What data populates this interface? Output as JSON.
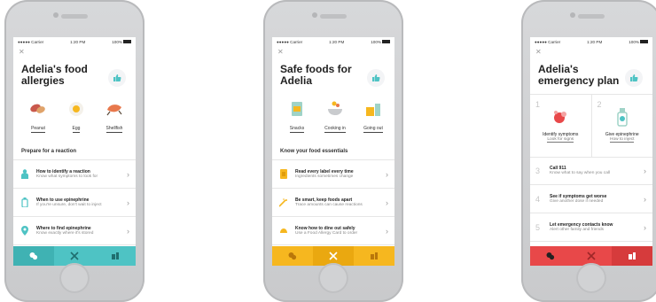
{
  "colors": {
    "teal": "#4ec3c4",
    "yellow": "#f6b71f",
    "red": "#e84849"
  },
  "status": {
    "carrier": "Carrier",
    "time": "1:20 PM",
    "battery": "100%"
  },
  "screens": [
    {
      "title": "Adelia's food allergies",
      "allergens": [
        {
          "label": "Peanut",
          "icon": "peanut-icon"
        },
        {
          "label": "Egg",
          "icon": "egg-icon"
        },
        {
          "label": "Shellfish",
          "icon": "shellfish-icon"
        }
      ],
      "section": "Prepare for a reaction",
      "rows": [
        {
          "title": "How to identify a reaction",
          "subtitle": "Know what symptoms to look for",
          "icon": "person-icon"
        },
        {
          "title": "When to use epinephrine",
          "subtitle": "If you're unsure, don't wait to inject",
          "icon": "epinephrine-icon"
        },
        {
          "title": "Where to find epinephrine",
          "subtitle": "Know exactly where it's stored",
          "icon": "location-pin-icon"
        }
      ]
    },
    {
      "title": "Safe foods for Adelia",
      "categories": [
        {
          "label": "Snacks",
          "icon": "snacks-icon"
        },
        {
          "label": "Cooking in",
          "icon": "cooking-icon"
        },
        {
          "label": "Going out",
          "icon": "going-out-icon"
        }
      ],
      "section": "Know your food essentials",
      "rows": [
        {
          "title": "Read every label every time",
          "subtitle": "Ingredients sometimes change",
          "icon": "label-icon"
        },
        {
          "title": "Be smart, keep foods apart",
          "subtitle": "Trace amounts can cause reactions",
          "icon": "crumbs-icon"
        },
        {
          "title": "Know how to dine out safely",
          "subtitle": "Use a Food Allergy Card to order",
          "icon": "dining-icon"
        }
      ]
    },
    {
      "title": "Adelia's emergency plan",
      "steps_top": [
        {
          "num": "1",
          "title": "Identify symptoms",
          "subtitle": "Look for signs",
          "icon": "symptoms-icon"
        },
        {
          "num": "2",
          "title": "Give epinephrine",
          "subtitle": "How to inject",
          "icon": "epinephrine-icon"
        }
      ],
      "steps": [
        {
          "num": "3",
          "title": "Call 911",
          "subtitle": "Know what to say when you call"
        },
        {
          "num": "4",
          "title": "See if symptoms get worse",
          "subtitle": "Give another dose if needed"
        },
        {
          "num": "5",
          "title": "Let emergency contacts know",
          "subtitle": "Alert other family and friends"
        }
      ]
    }
  ]
}
